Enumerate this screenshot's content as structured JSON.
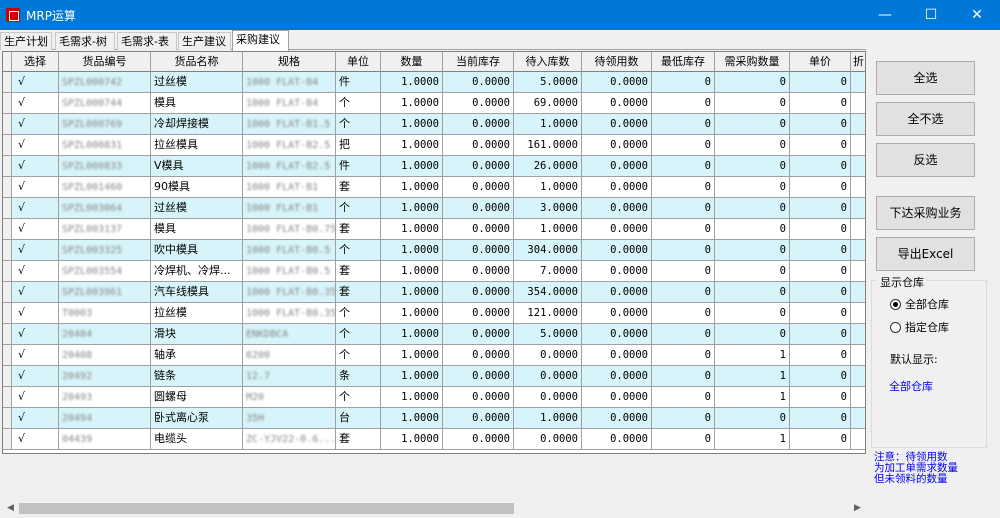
{
  "window": {
    "title": "MRP运算",
    "min_glyph": "—",
    "max_glyph": "☐",
    "close_glyph": "✕"
  },
  "tabs": [
    "生产计划",
    "毛需求-树",
    "毛需求-表",
    "生产建议",
    "采购建议"
  ],
  "active_tab": "采购建议",
  "columns": [
    "选择",
    "货品编号",
    "货品名称",
    "规格",
    "单位",
    "数量",
    "当前库存",
    "待入库数",
    "待领用数",
    "最低库存",
    "需采购数量",
    "单价",
    "折"
  ],
  "rows": [
    {
      "sel": "√",
      "code": "SPZL000742",
      "code_tail": "00742",
      "name": "过丝模",
      "spec": "1000 FLAT-B4",
      "spec_tail": "-B4",
      "unit": "件",
      "qty": "1.0000",
      "stock": "0.0000",
      "incoming": "5.0000",
      "pending": "0.0000",
      "min": "0",
      "need": "0",
      "price": "0"
    },
    {
      "sel": "√",
      "code": "SPZL000744",
      "code_tail": "00744",
      "name": "模具",
      "spec": "1000 FLAT-B4",
      "spec_tail": "-B4",
      "unit": "个",
      "qty": "1.0000",
      "stock": "0.0000",
      "incoming": "69.0000",
      "pending": "0.0000",
      "min": "0",
      "need": "0",
      "price": "0"
    },
    {
      "sel": "√",
      "code": "SPZL000769",
      "code_tail": "00769",
      "name": "冷却焊接模",
      "spec": "1000 FLAT-B1.5",
      "spec_tail": "-B1.5",
      "unit": "个",
      "qty": "1.0000",
      "stock": "0.0000",
      "incoming": "1.0000",
      "pending": "0.0000",
      "min": "0",
      "need": "0",
      "price": "0"
    },
    {
      "sel": "√",
      "code": "SPZL000831",
      "code_tail": "00831",
      "name": "拉丝模具",
      "spec": "1000 FLAT-B2.5",
      "spec_tail": "-B2.5",
      "unit": "把",
      "qty": "1.0000",
      "stock": "0.0000",
      "incoming": "161.0000",
      "pending": "0.0000",
      "min": "0",
      "need": "0",
      "price": "0"
    },
    {
      "sel": "√",
      "code": "SPZL000833",
      "code_tail": "00833",
      "name": "V模具",
      "spec": "1000 FLAT-B2.5",
      "spec_tail": "-B2.5",
      "unit": "件",
      "qty": "1.0000",
      "stock": "0.0000",
      "incoming": "26.0000",
      "pending": "0.0000",
      "min": "0",
      "need": "0",
      "price": "0"
    },
    {
      "sel": "√",
      "code": "SPZL001460",
      "code_tail": "01460",
      "name": "90模具",
      "spec": "1000 FLAT-B1",
      "spec_tail": "-B1",
      "unit": "套",
      "qty": "1.0000",
      "stock": "0.0000",
      "incoming": "1.0000",
      "pending": "0.0000",
      "min": "0",
      "need": "0",
      "price": "0"
    },
    {
      "sel": "√",
      "code": "SPZL003064",
      "code_tail": "03064",
      "name": "过丝模",
      "spec": "1000 FLAT-B1",
      "spec_tail": "-B1",
      "unit": "个",
      "qty": "1.0000",
      "stock": "0.0000",
      "incoming": "3.0000",
      "pending": "0.0000",
      "min": "0",
      "need": "0",
      "price": "0"
    },
    {
      "sel": "√",
      "code": "SPZL003137",
      "code_tail": "03137",
      "name": "模具",
      "spec": "1000 FLAT-B0.75",
      "spec_tail": "-B0.75",
      "unit": "套",
      "qty": "1.0000",
      "stock": "0.0000",
      "incoming": "1.0000",
      "pending": "0.0000",
      "min": "0",
      "need": "0",
      "price": "0"
    },
    {
      "sel": "√",
      "code": "SPZL003325",
      "code_tail": "03325",
      "name": "吹中模具",
      "spec": "1000 FLAT-B0.5",
      "spec_tail": "-B0.5",
      "unit": "个",
      "qty": "1.0000",
      "stock": "0.0000",
      "incoming": "304.0000",
      "pending": "0.0000",
      "min": "0",
      "need": "0",
      "price": "0"
    },
    {
      "sel": "√",
      "code": "SPZL003554",
      "code_tail": "03554",
      "name": "冷焊机、冷焊...",
      "spec": "1000 FLAT-B0.5",
      "spec_tail": "-B0.5",
      "unit": "套",
      "qty": "1.0000",
      "stock": "0.0000",
      "incoming": "7.0000",
      "pending": "0.0000",
      "min": "0",
      "need": "0",
      "price": "0"
    },
    {
      "sel": "√",
      "code": "SPZL003961",
      "code_tail": "03961",
      "name": "汽车线模具",
      "spec": "1000 FLAT-B0.35",
      "spec_tail": "-B0.35",
      "unit": "套",
      "qty": "1.0000",
      "stock": "0.0000",
      "incoming": "354.0000",
      "pending": "0.0000",
      "min": "0",
      "need": "0",
      "price": "0"
    },
    {
      "sel": "√",
      "code": "T0003",
      "code_tail": "",
      "name": "拉丝模",
      "spec": "1000 FLAT-B0.35",
      "spec_tail": "-B0.35",
      "unit": "个",
      "qty": "1.0000",
      "stock": "0.0000",
      "incoming": "121.0000",
      "pending": "0.0000",
      "min": "0",
      "need": "0",
      "price": "0"
    },
    {
      "sel": "√",
      "code": "20404",
      "code_tail": "",
      "name": "滑块",
      "spec": "ENKDBCA",
      "spec_tail": "",
      "unit": "个",
      "qty": "1.0000",
      "stock": "0.0000",
      "incoming": "5.0000",
      "pending": "0.0000",
      "min": "0",
      "need": "0",
      "price": "0"
    },
    {
      "sel": "√",
      "code": "20408",
      "code_tail": "",
      "name": "轴承",
      "spec": "6200",
      "spec_tail": "",
      "unit": "个",
      "qty": "1.0000",
      "stock": "0.0000",
      "incoming": "0.0000",
      "pending": "0.0000",
      "min": "0",
      "need": "1",
      "price": "0"
    },
    {
      "sel": "√",
      "code": "20492",
      "code_tail": "",
      "name": "链条",
      "spec": "12.7",
      "spec_tail": "",
      "unit": "条",
      "qty": "1.0000",
      "stock": "0.0000",
      "incoming": "0.0000",
      "pending": "0.0000",
      "min": "0",
      "need": "1",
      "price": "0"
    },
    {
      "sel": "√",
      "code": "20493",
      "code_tail": "",
      "name": "圆螺母",
      "spec": "M20",
      "spec_tail": "",
      "unit": "个",
      "qty": "1.0000",
      "stock": "0.0000",
      "incoming": "0.0000",
      "pending": "0.0000",
      "min": "0",
      "need": "1",
      "price": "0"
    },
    {
      "sel": "√",
      "code": "20494",
      "code_tail": "",
      "name": "卧式离心泵",
      "spec": "35H",
      "spec_tail": "",
      "unit": "台",
      "qty": "1.0000",
      "stock": "0.0000",
      "incoming": "1.0000",
      "pending": "0.0000",
      "min": "0",
      "need": "0",
      "price": "0"
    },
    {
      "sel": "√",
      "code": "04439",
      "code_tail": "",
      "name": "电缆头",
      "spec": "ZC-YJV22-0.6...",
      "spec_tail": "-0.6...",
      "unit": "套",
      "qty": "1.0000",
      "stock": "0.0000",
      "incoming": "0.0000",
      "pending": "0.0000",
      "min": "0",
      "need": "1",
      "price": "0"
    }
  ],
  "buttons": {
    "select_all": "全选",
    "select_none": "全不选",
    "invert": "反选",
    "issue_purchase": "下达采购业务",
    "export_excel": "导出Excel"
  },
  "warehouse": {
    "group_title": "显示仓库",
    "all": "全部仓库",
    "specific": "指定仓库",
    "default_label": "默认显示:",
    "default_value": "全部仓库"
  },
  "note": [
    "注意：待领用数",
    "为加工单需求数量",
    "但未领料的数量"
  ],
  "colors": {
    "title_bar": "#0078d7",
    "row_alt": "#d6f4f9",
    "link_blue": "#0000ff"
  }
}
